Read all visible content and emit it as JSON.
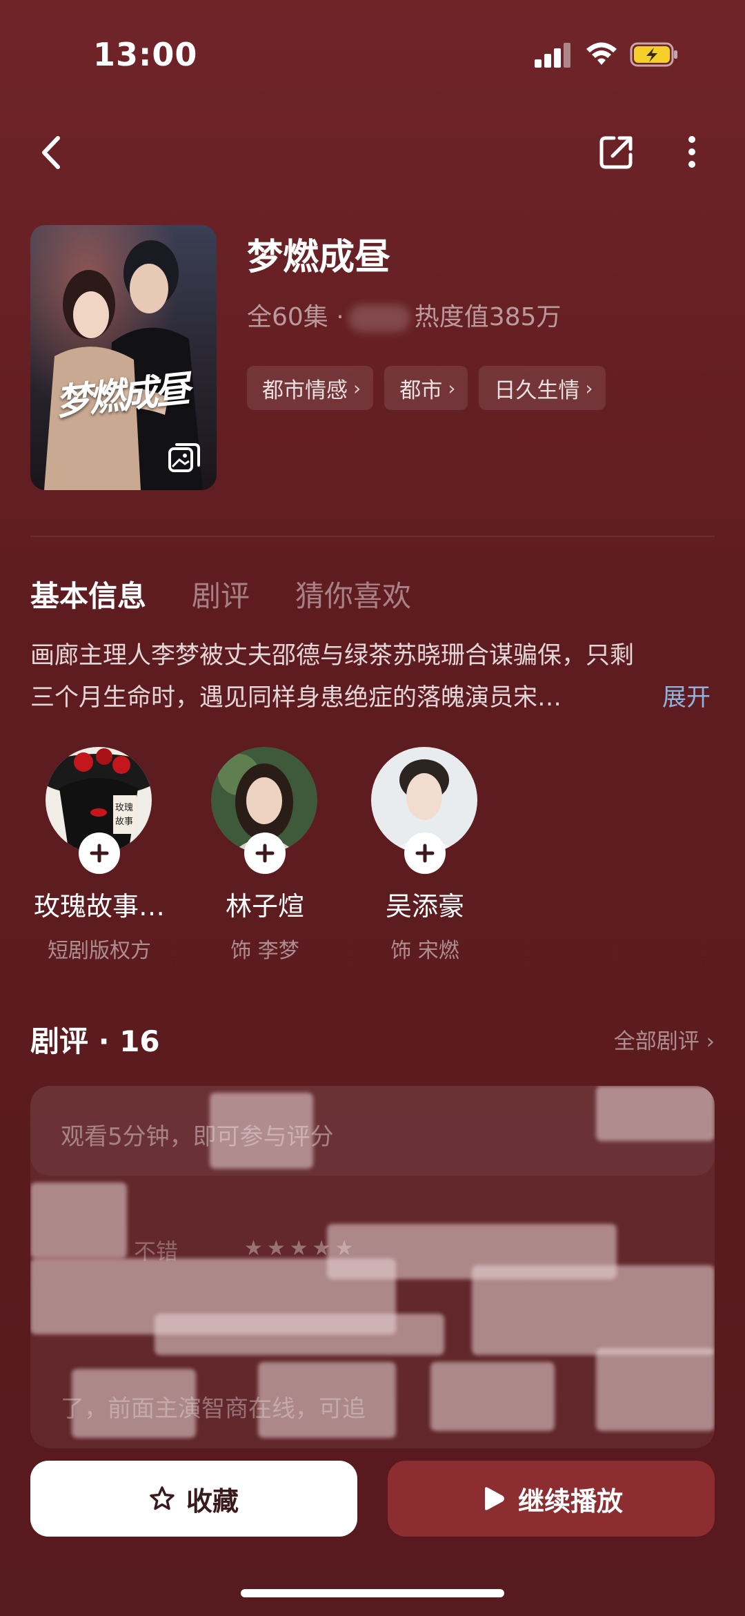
{
  "status_bar": {
    "time": "13:00"
  },
  "drama": {
    "title": "梦燃成昼",
    "episodes": "全60集 ·",
    "heat": "热度值385万",
    "tags": [
      "都市情感",
      "都市",
      "日久生情"
    ],
    "poster_title": "梦燃成昼"
  },
  "tabs": [
    {
      "label": "基本信息",
      "active": true
    },
    {
      "label": "剧评",
      "active": false
    },
    {
      "label": "猜你喜欢",
      "active": false
    }
  ],
  "synopsis": {
    "line1": "画廊主理人李梦被丈夫邵德与绿茶苏晓珊合谋骗保，只剩",
    "line2": "三个月生命时，遇见同样身患绝症的落魄演员宋…",
    "expand_label": "展开"
  },
  "cast": [
    {
      "name": "玫瑰故事…",
      "role": "短剧版权方"
    },
    {
      "name": "林子煊",
      "role": "饰 李梦"
    },
    {
      "name": "吴添豪",
      "role": "饰 宋燃"
    }
  ],
  "reviews": {
    "title": "剧评 · 16",
    "all_label": "全部剧评",
    "prompt": "观看5分钟，即可参与评分",
    "label": "不错",
    "stars": "★★★★★",
    "bottom_text": "了，前面主演智商在线，可追"
  },
  "actions": {
    "collect_label": "收藏",
    "play_label": "继续播放"
  },
  "colors": {
    "accent": "#8c2e31",
    "link": "#8fb3dc",
    "background": "#5e1c20"
  }
}
